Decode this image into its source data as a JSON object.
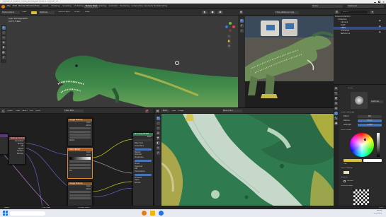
{
  "app": {
    "title": "Blender [C:\\Users\\...\\TRex_texture_paint.blend] - Blender 3.x"
  },
  "menubar": {
    "items": [
      "File",
      "Edit",
      "Render",
      "Window",
      "Help"
    ],
    "workspaces": [
      "Layout",
      "Modeling",
      "Sculpting",
      "UV Editing",
      "Texture Paint",
      "Shading",
      "Animation",
      "Rendering",
      "Compositing",
      "Geometry Nodes",
      "Scripting"
    ],
    "active_workspace": "Texture Paint",
    "scene": "Scene",
    "view_layer": "ViewLayer"
  },
  "viewport": {
    "mode": "Texture Paint",
    "header_buttons": [
      "View",
      "Texture Slots",
      "Brush",
      "Mask"
    ],
    "overlay_line1": "User Orthographic",
    "overlay_line2": "(227) T-Rex",
    "brush_name": "TexDraw"
  },
  "image_editor_top": {
    "image_name": "T-Rex_Reference.jpg"
  },
  "node_editor": {
    "header_buttons": [
      "Object",
      "View",
      "Select",
      "Add",
      "Node"
    ],
    "material": "T-Rex Mat",
    "nodes": [
      {
        "title": "Texture Coordinate",
        "rows": [
          "Generated",
          "Normal",
          "UV",
          "Object",
          "Camera",
          "Window",
          "Reflection"
        ]
      },
      {
        "title": "Image Texture",
        "rows": [
          "Color",
          "Alpha",
          "Vector"
        ]
      },
      {
        "title": "Color Ramp",
        "rows": [
          "Color",
          "Alpha",
          "Fac"
        ]
      },
      {
        "title": "Image Texture",
        "rows": [
          "Color",
          "Alpha"
        ]
      },
      {
        "title": "Principled BSDF",
        "rows": [
          "BSDF",
          "Base Color",
          "Subsurface",
          "Metallic",
          "Specular",
          "Roughness",
          "Sheen",
          "Clearcoat",
          "IOR",
          "Transmission",
          "Emission",
          "Alpha",
          "Normal"
        ]
      }
    ]
  },
  "uv_editor": {
    "header_buttons": [
      "View",
      "Image"
    ],
    "image_name": "Base Color",
    "mode": "Paint"
  },
  "outliner": {
    "title": "Scene Collection",
    "search_placeholder": "Search",
    "rows": [
      "Scene Collection",
      "Collection",
      "Camera",
      "Light",
      "T-Rex",
      "Armature",
      "Reference"
    ]
  },
  "properties": {
    "brush_title": "Brush",
    "brush_name": "TexDraw",
    "sections": [
      "Brush Settings",
      "Blend",
      "Radius",
      "Strength",
      "Color Picker",
      "Color Palette",
      "Texture",
      "Texture Mask",
      "Stroke",
      "Falloff"
    ],
    "blend_value": "Mix",
    "radius_value": "50 px",
    "strength_value": "1.000",
    "hex_label": "Hex",
    "texture_label": "Texture"
  },
  "status_bar": {
    "left": "Select",
    "middle": "Pan View",
    "right": "Context Menu",
    "version": "3.4.1"
  },
  "taskbar": {
    "time": "10:42",
    "date": "3/7/2023"
  },
  "colors": {
    "accent": "#4772b3",
    "selected_node": "#e08a2a",
    "texture_green": "#2f7a4f",
    "paint_yellow": "#d8c33a"
  }
}
